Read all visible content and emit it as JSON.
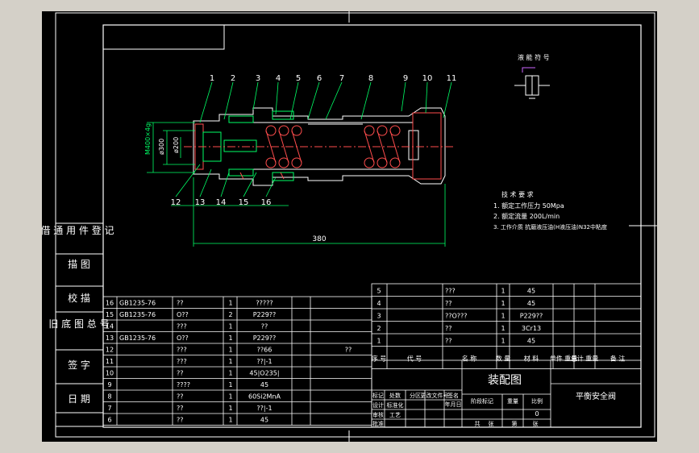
{
  "viewport": {
    "background": "#000000",
    "frame_color": "#ffffff",
    "dim_color": "#00ff66",
    "part_color": "#ffffff",
    "spring_color": "#ff4d4d"
  },
  "callouts": {
    "top": [
      "1",
      "2",
      "3",
      "4",
      "5",
      "6",
      "7",
      "8",
      "9",
      "10",
      "11"
    ],
    "bottom": [
      "12",
      "13",
      "14",
      "15",
      "16"
    ]
  },
  "dims": {
    "overall": "380",
    "height": "ø300",
    "bore": "ø200",
    "thread": "M400×4g"
  },
  "symbol": {
    "title": "液 能 符 号"
  },
  "tech": {
    "title": "技 术 要 求",
    "items": [
      "1. 额定工作压力 50Mpa",
      "2. 额定流量 200L/min",
      "3. 工作介质 抗磨液压油(H液压油)N32中粘度"
    ]
  },
  "left_strip": [
    "借 通 用 件 登 记",
    "描 图",
    "校 描",
    "旧 底 图 总 号",
    "签 字",
    "日 期"
  ],
  "bom_left": [
    {
      "no": "16",
      "code": "GB1235-76",
      "name": "??",
      "qty": "1",
      "mat": "?????"
    },
    {
      "no": "15",
      "code": "GB1235-76",
      "name": "O??",
      "qty": "2",
      "mat": "P229??"
    },
    {
      "no": "14",
      "code": "",
      "name": "???",
      "qty": "1",
      "mat": "??"
    },
    {
      "no": "13",
      "code": "GB1235-76",
      "name": "O??",
      "qty": "1",
      "mat": "P229??"
    },
    {
      "no": "12",
      "code": "",
      "name": "???",
      "qty": "1",
      "mat": "??66"
    },
    {
      "no": "11",
      "code": "",
      "name": "???",
      "qty": "1",
      "mat": "??|-1"
    },
    {
      "no": "10",
      "code": "",
      "name": "??",
      "qty": "1",
      "mat": "45|O235|"
    },
    {
      "no": "9",
      "code": "",
      "name": "????",
      "qty": "1",
      "mat": "45"
    },
    {
      "no": "8",
      "code": "",
      "name": "??",
      "qty": "1",
      "mat": "60Si2MnA"
    },
    {
      "no": "7",
      "code": "",
      "name": "??",
      "qty": "1",
      "mat": "??|-1"
    },
    {
      "no": "6",
      "code": "",
      "name": "??",
      "qty": "1",
      "mat": "45"
    }
  ],
  "bom_left_note": "??",
  "bom_right": [
    {
      "no": "5",
      "name": "???",
      "qty": "1",
      "mat": "45"
    },
    {
      "no": "4",
      "name": "??",
      "qty": "1",
      "mat": "45"
    },
    {
      "no": "3",
      "name": "??O???",
      "qty": "1",
      "mat": "P229??"
    },
    {
      "no": "2",
      "name": "??",
      "qty": "1",
      "mat": "3Cr13"
    },
    {
      "no": "1",
      "name": "??",
      "qty": "1",
      "mat": "45"
    }
  ],
  "bom_header": [
    "序 号",
    "代 号",
    "名 称",
    "数 量",
    "材 料",
    "单件 重量",
    "总计 重量",
    "备 注"
  ],
  "title_block": {
    "drawing_name": "装配图",
    "part_name": "平衡安全阀",
    "labels": [
      "标记",
      "处数",
      "分区",
      "更改文件号",
      "签名",
      "年月日",
      "设计",
      "标准化",
      "阶段标记",
      "重量",
      "比例",
      "审核",
      "工艺",
      "批准",
      "共",
      "张",
      "第",
      "张"
    ],
    "values": [
      "",
      "0"
    ]
  }
}
